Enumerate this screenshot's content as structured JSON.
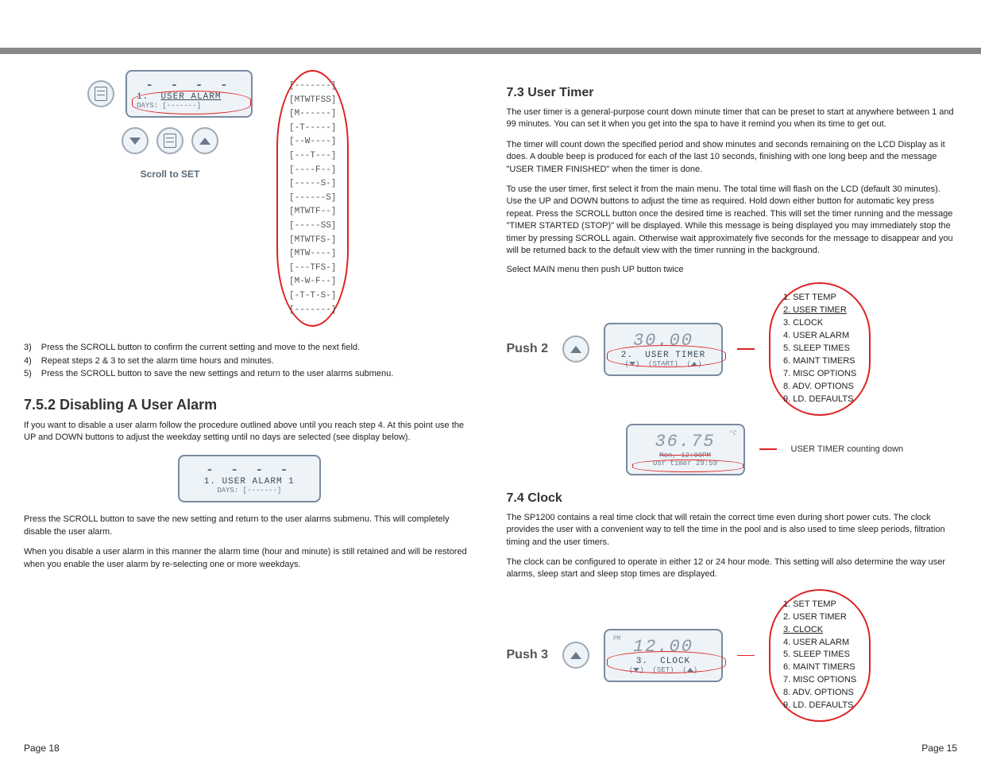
{
  "left": {
    "lcd1_dashes": "- - - -",
    "lcd1_line1a": "1.",
    "lcd1_line1b": "USER ALARM",
    "lcd1_line2": "DAYS:   [-------]",
    "scroll_label": "Scroll to SET",
    "days_options": [
      "[-------]",
      "[MTWTFSS]",
      "[M------]",
      "[-T-----]",
      "[--W----]",
      "[---T---]",
      "[----F--]",
      "[-----S-]",
      "[------S]",
      "[MTWTF--]",
      "[-----SS]",
      "[MTWTFS-]",
      "[MTW----]",
      "[---TFS-]",
      "[M-W-F--]",
      "[-T-T-S-]",
      "[-------]"
    ],
    "steps": [
      {
        "n": "3)",
        "t": "Press the SCROLL button to confirm the current setting and move to the next field."
      },
      {
        "n": "4)",
        "t": "Repeat steps 2 & 3 to set the alarm time hours and minutes."
      },
      {
        "n": "5)",
        "t": "Press the SCROLL button to save the new settings and return to the user alarms submenu."
      }
    ],
    "h752": "7.5.2  Disabling A User Alarm",
    "p752": "If you want to disable a user alarm follow the procedure outlined above until you reach step 4.  At this point use the UP and DOWN buttons to adjust the weekday setting until no days are selected (see display below).",
    "lcd2_dashes": "- - - -",
    "lcd2_line1": "1.   USER ALARM  1",
    "lcd2_line2": "DAYS:    [-------]",
    "p752b": "Press the SCROLL button to save the new setting and return to the user alarms submenu.  This will completely disable the user alarm.",
    "p752c": "When you disable a user alarm in this manner the alarm time (hour and minute) is still retained and will be restored when you enable the user alarm by re-selecting one or more weekdays."
  },
  "right": {
    "h73": "7.3 User Timer",
    "p73a": "The user timer is a general-purpose count down minute timer that can be preset to start at anywhere between 1 and 99 minutes.  You can set it when you get into the spa to have it remind you when its time to get out.",
    "p73b": "The timer will count down the specified period and show minutes and seconds remaining on the LCD Display as it does.  A double beep is produced for each of the last 10 seconds, finishing with one long beep and the message \"USER TIMER FINISHED\" when the timer is done.",
    "p73c": "To use the user timer, first select it from the main menu.  The total time will flash on the LCD (default 30 minutes).  Use the UP and DOWN buttons to adjust the time as required.  Hold down either button for automatic key press repeat.  Press the SCROLL button once the desired time is reached.  This will set the timer running and the message \"TIMER STARTED (STOP)\" will be displayed.  While this message is being displayed you may immediately stop the timer by pressing SCROLL again.  Otherwise wait approximately five seconds for the message to disappear and you will be returned back to the default view with the timer running in the background.",
    "select_main": "Select MAIN menu then push UP button twice",
    "push2": "Push 2",
    "lcd_timer_num": "30.00",
    "lcd_timer_l1a": "2.",
    "lcd_timer_l1b": "USER  TIMER",
    "lcd_timer_l2": "(START)",
    "menu": [
      "1.  SET TEMP",
      "2.  USER TIMER",
      "3.  CLOCK",
      "4.  USER ALARM",
      "5.  SLEEP TIMES",
      "6.  MAINT TIMERS",
      "7.  MISC OPTIONS",
      "8.  ADV. OPTIONS",
      "9.  LD. DEFAULTS"
    ],
    "lcd_count_num": "36.75",
    "lcd_count_l1": "Mon,    12:00PM",
    "lcd_count_l2": "Usr  timer 29:59",
    "count_label": "USER TIMER counting down",
    "h74": "7.4 Clock",
    "p74a": "The SP1200 contains a real time clock that will retain the correct time even during short power cuts.  The clock provides the user with a convenient way to tell the time in the pool and is also used to time sleep periods, filtration timing and the user timers.",
    "p74b": "The clock can be configured to operate in either 12 or 24 hour mode.  This setting will also determine the way user alarms, sleep start and sleep stop times are displayed.",
    "push3": "Push 3",
    "lcd_clock_num": "12.00",
    "lcd_clock_pm": "PM",
    "lcd_clock_l1a": "3.",
    "lcd_clock_l1b": "CLOCK",
    "lcd_clock_l2": "(SET)"
  },
  "footer": {
    "left": "Page 18",
    "right": "Page 15"
  }
}
